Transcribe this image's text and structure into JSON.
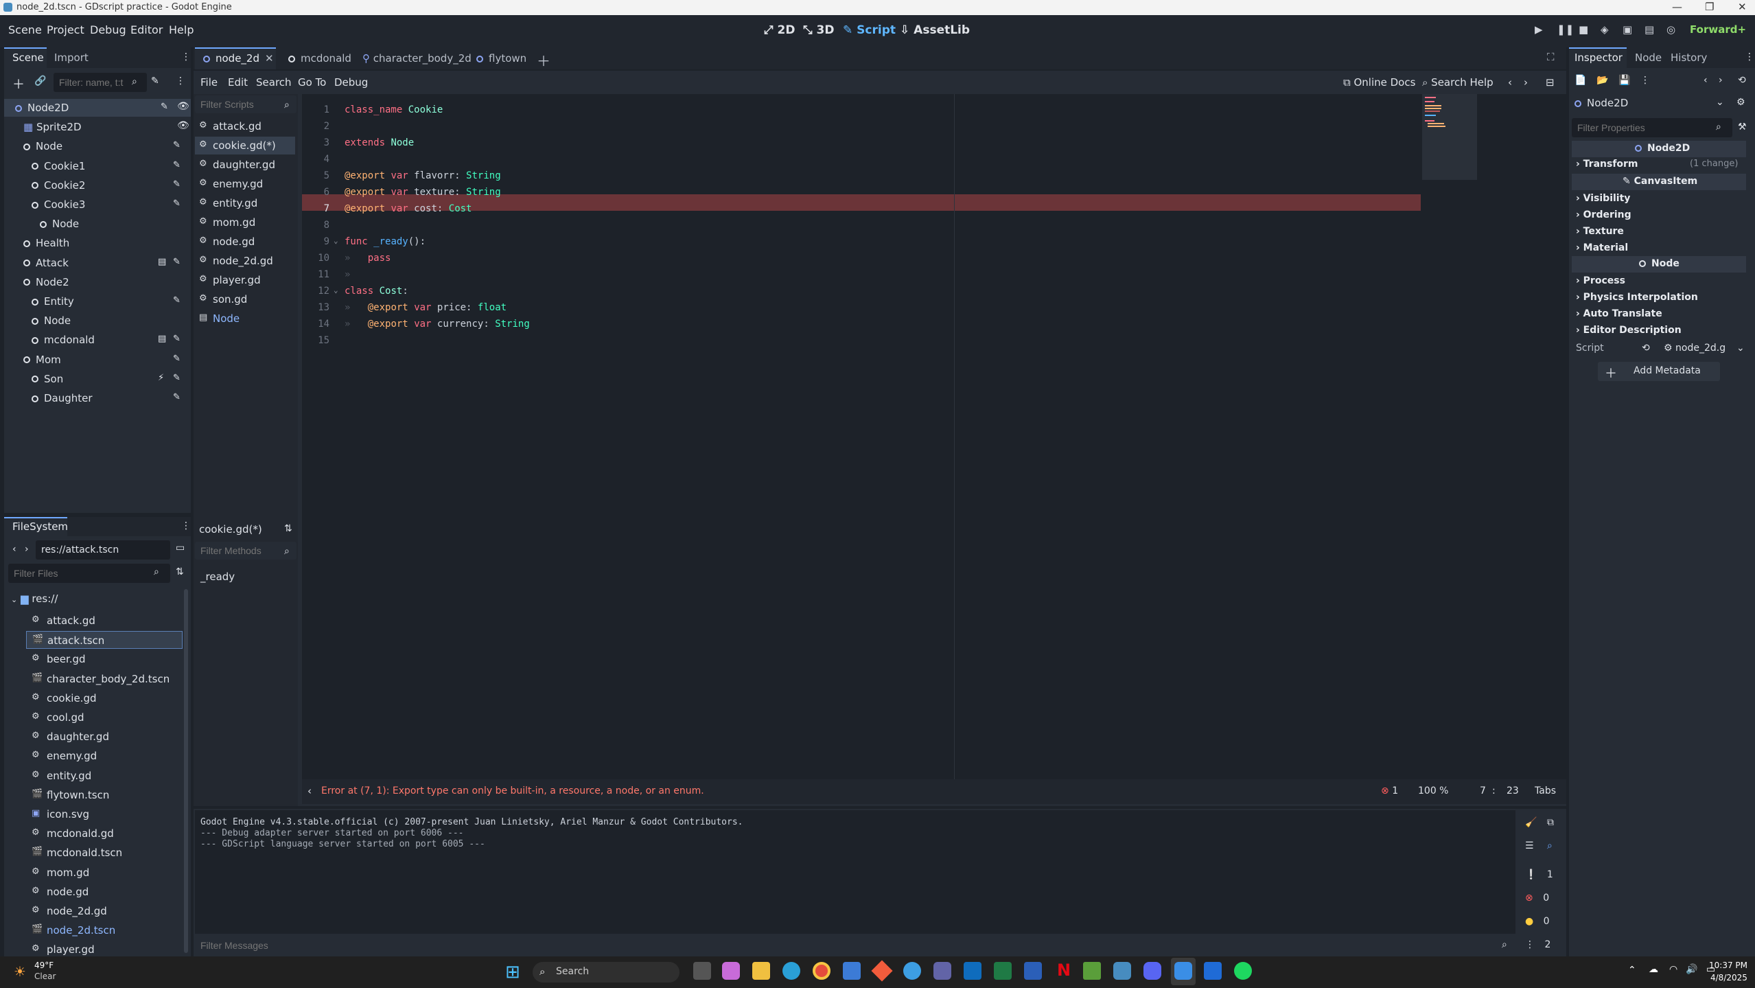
{
  "window": {
    "title": "node_2d.tscn - GDscript practice - Godot Engine"
  },
  "menu": {
    "items": [
      "Scene",
      "Project",
      "Debug",
      "Editor",
      "Help"
    ]
  },
  "workspaces": {
    "w2d": "2D",
    "w3d": "3D",
    "script": "Script",
    "assetlib": "AssetLib"
  },
  "renderer": "Forward+",
  "scene_dock": {
    "tabs": [
      "Scene",
      "Import"
    ],
    "filter_placeholder": "Filter: name, t:t",
    "nodes": [
      {
        "label": "Node2D",
        "depth": 0,
        "selected": true
      },
      {
        "label": "Sprite2D",
        "depth": 1
      },
      {
        "label": "Node",
        "depth": 1
      },
      {
        "label": "Cookie1",
        "depth": 2
      },
      {
        "label": "Cookie2",
        "depth": 2
      },
      {
        "label": "Cookie3",
        "depth": 2
      },
      {
        "label": "Node",
        "depth": 3
      },
      {
        "label": "Health",
        "depth": 1
      },
      {
        "label": "Attack",
        "depth": 1
      },
      {
        "label": "Node2",
        "depth": 1
      },
      {
        "label": "Entity",
        "depth": 2
      },
      {
        "label": "Node",
        "depth": 2
      },
      {
        "label": "mcdonald",
        "depth": 2
      },
      {
        "label": "Mom",
        "depth": 1
      },
      {
        "label": "Son",
        "depth": 2
      },
      {
        "label": "Daughter",
        "depth": 2
      }
    ]
  },
  "filesystem": {
    "tab": "FileSystem",
    "path": "res://attack.tscn",
    "filter_placeholder": "Filter Files",
    "root": "res://",
    "files": [
      "attack.gd",
      "attack.tscn",
      "beer.gd",
      "character_body_2d.tscn",
      "cookie.gd",
      "cool.gd",
      "daughter.gd",
      "enemy.gd",
      "entity.gd",
      "flytown.tscn",
      "icon.svg",
      "mcdonald.gd",
      "mcdonald.tscn",
      "mom.gd",
      "node.gd",
      "node_2d.gd",
      "node_2d.tscn",
      "player.gd"
    ],
    "selected": "attack.tscn"
  },
  "editor_tabs": [
    "node_2d",
    "mcdonald",
    "character_body_2d",
    "flytown"
  ],
  "script_menu": [
    "File",
    "Edit",
    "Search",
    "Go To",
    "Debug"
  ],
  "script_toolbar": {
    "online_docs": "Online Docs",
    "search_help": "Search Help"
  },
  "script_list": {
    "filter_placeholder": "Filter Scripts",
    "items": [
      "attack.gd",
      "cookie.gd(*)",
      "daughter.gd",
      "enemy.gd",
      "entity.gd",
      "mom.gd",
      "node.gd",
      "node_2d.gd",
      "player.gd",
      "son.gd",
      "Node"
    ],
    "selected": "cookie.gd(*)",
    "current": "cookie.gd(*)",
    "methods_placeholder": "Filter Methods",
    "methods": [
      "_ready"
    ]
  },
  "code_lines": [
    "1",
    "2",
    "3",
    "4",
    "5",
    "6",
    "7",
    "8",
    "9",
    "10",
    "11",
    "12",
    "13",
    "14",
    "15"
  ],
  "status": {
    "error": "Error at (7, 1): Export type can only be built-in, a resource, a node, or an enum.",
    "error_count": "1",
    "zoom": "100 %",
    "line": "7",
    "col": "23",
    "indent": "Tabs"
  },
  "output": {
    "lines": [
      "Godot Engine v4.3.stable.official (c) 2007-present Juan Linietsky, Ariel Manzur & Godot Contributors.",
      "--- Debug adapter server started on port 6006 ---",
      "--- GDScript language server started on port 6005 ---"
    ],
    "filter_placeholder": "Filter Messages",
    "counts": [
      "1",
      "0",
      "0",
      "2"
    ]
  },
  "inspector": {
    "tabs": [
      "Inspector",
      "Node",
      "History"
    ],
    "node": "Node2D",
    "filter_placeholder": "Filter Properties",
    "class1": "Node2D",
    "transform": "Transform",
    "transform_change": "(1 change)",
    "class2": "CanvasItem",
    "sections1": [
      "Visibility",
      "Ordering",
      "Texture",
      "Material"
    ],
    "class3": "Node",
    "sections2": [
      "Process",
      "Physics Interpolation",
      "Auto Translate",
      "Editor Description"
    ],
    "script_label": "Script",
    "script_value": "node_2d.g",
    "add_metadata": "Add Metadata"
  },
  "taskbar": {
    "weather_temp": "49°F",
    "weather_desc": "Clear",
    "search": "Search",
    "time": "10:37 PM",
    "date": "4/8/2025"
  }
}
